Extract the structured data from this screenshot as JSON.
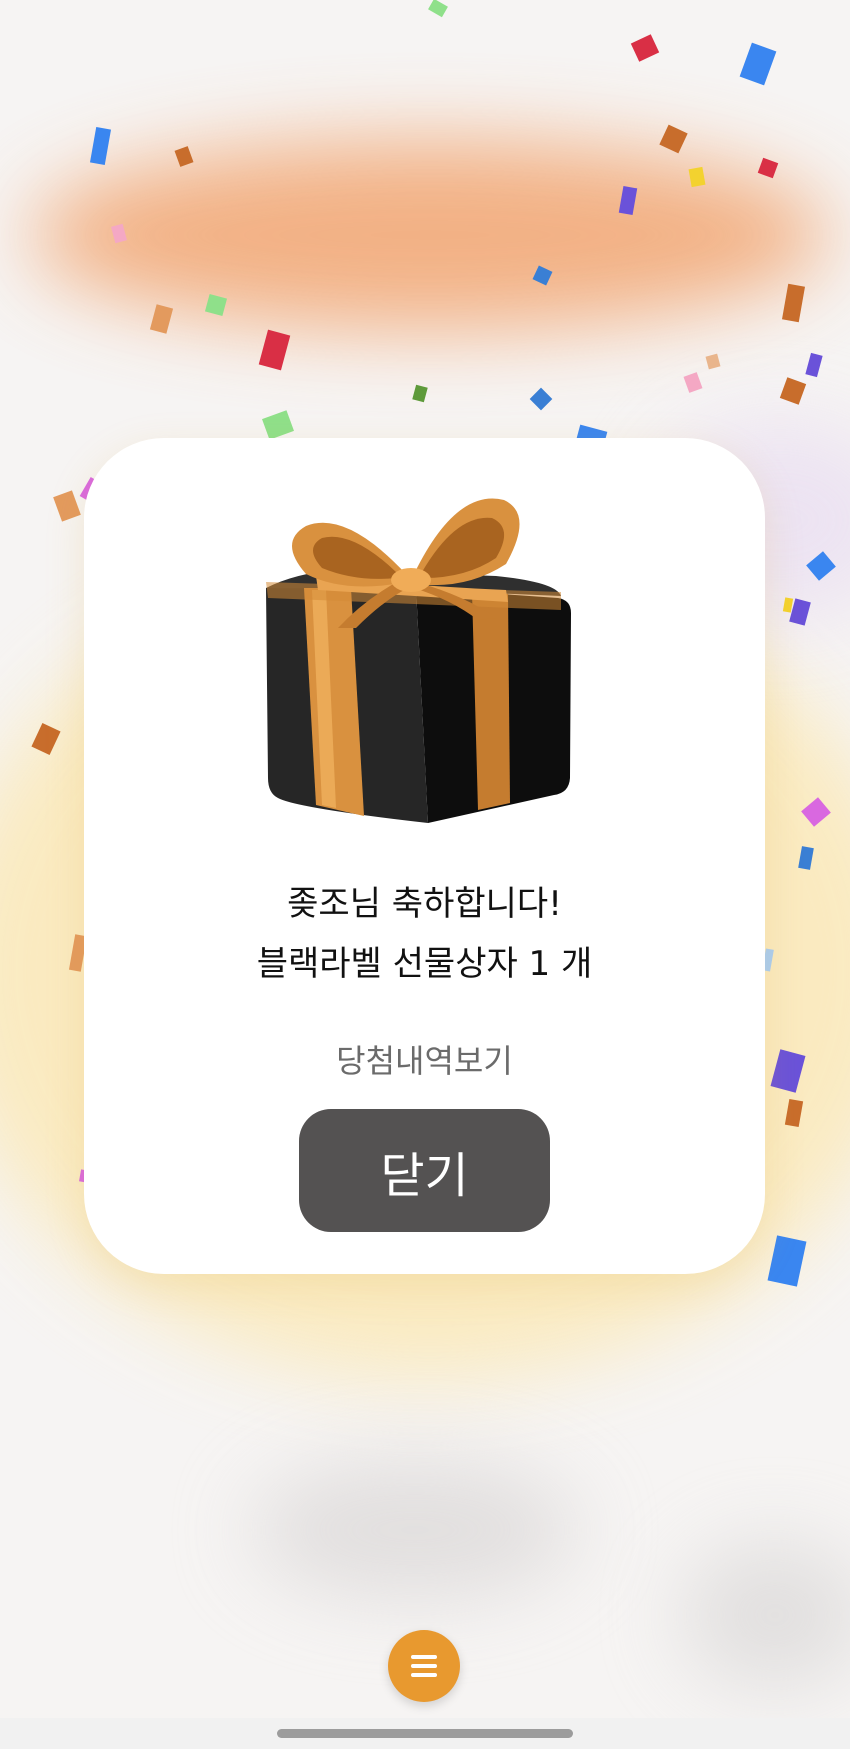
{
  "dialog": {
    "congrats_text": "좆조님 축하합니다!",
    "prize_text": "블랙라벨 선물상자 1 개",
    "history_link": "당첨내역보기",
    "close_label": "닫기"
  },
  "colors": {
    "card_bg": "#ffffff",
    "close_button_bg": "#545252",
    "menu_fab_bg": "#e8992f",
    "gift_box": "#1b1b1b",
    "gift_ribbon": "#d9913f"
  },
  "icons": {
    "gift": "gift-box-icon",
    "menu": "hamburger-menu-icon"
  }
}
